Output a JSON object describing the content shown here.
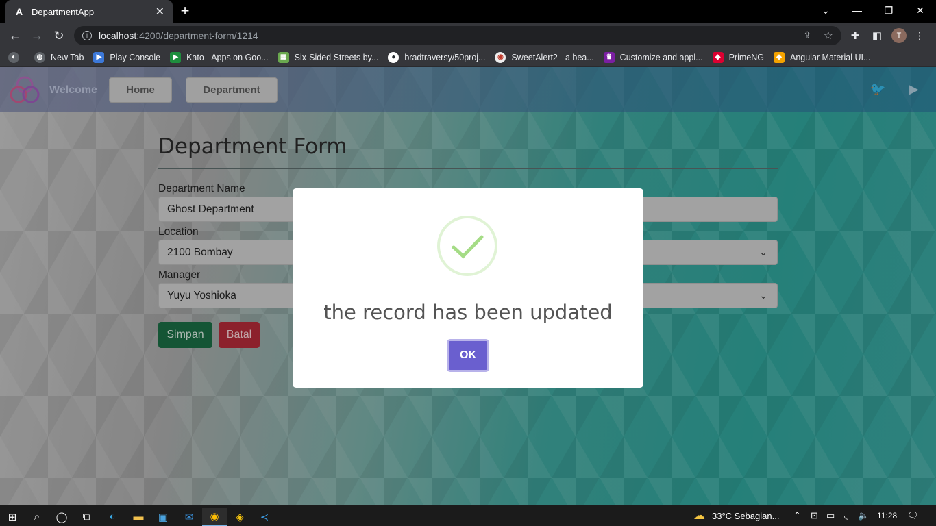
{
  "browser": {
    "tab_title": "DepartmentApp",
    "tab_icon": "A",
    "url_host": "localhost",
    "url_path": ":4200/department-form/1214",
    "profile_initial": "T"
  },
  "bookmarks": [
    {
      "label": "New Tab",
      "color": "#5f6368"
    },
    {
      "label": "Play Console",
      "color": "#3c78d8"
    },
    {
      "label": "Kato - Apps on Goo...",
      "color": "#1e8e3e"
    },
    {
      "label": "Six-Sided Streets by...",
      "color": "#6aa84f"
    },
    {
      "label": "bradtraversy/50proj...",
      "color": "#24292e"
    },
    {
      "label": "SweetAlert2 - a bea...",
      "color": "#c0392b"
    },
    {
      "label": "Customize and appl...",
      "color": "#7b1fa2"
    },
    {
      "label": "PrimeNG",
      "color": "#dd0031"
    },
    {
      "label": "Angular Material UI...",
      "color": "#f4a300"
    }
  ],
  "navbar": {
    "brand": "Welcome",
    "home": "Home",
    "department": "Department"
  },
  "form": {
    "title": "Department Form",
    "name_label": "Department Name",
    "name_value": "Ghost Department",
    "location_label": "Location",
    "location_value": "2100 Bombay",
    "manager_label": "Manager",
    "manager_value": "Yuyu Yoshioka",
    "save": "Simpan",
    "cancel": "Batal"
  },
  "modal": {
    "message": "the record has been updated",
    "ok": "OK",
    "check_color": "#a5dc86"
  },
  "taskbar": {
    "weather": "33°C  Sebagian...",
    "time": "11:28"
  }
}
